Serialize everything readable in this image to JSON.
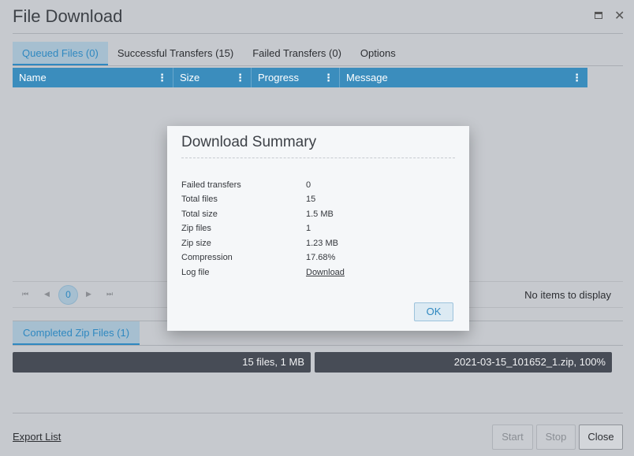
{
  "window": {
    "title": "File Download"
  },
  "tabs": [
    {
      "label": "Queued Files (0)",
      "active": true
    },
    {
      "label": "Successful Transfers (15)",
      "active": false
    },
    {
      "label": "Failed Transfers (0)",
      "active": false
    },
    {
      "label": "Options",
      "active": false
    }
  ],
  "grid": {
    "columns": [
      "Name",
      "Size",
      "Progress",
      "Message"
    ],
    "menu_glyph": "⋮"
  },
  "pager": {
    "first": "⏮",
    "prev": "◀",
    "page": "0",
    "next": "▶",
    "last": "⏭",
    "status": "No items to display"
  },
  "zip_tab": {
    "label": "Completed Zip Files (1)"
  },
  "zip_rows": [
    {
      "files": "15 files, 1 MB",
      "zip": "2021-03-15_101652_1.zip, 100%"
    }
  ],
  "footer": {
    "export": "Export List",
    "start": "Start",
    "stop": "Stop",
    "close": "Close"
  },
  "icons": {
    "maximize": "maximize-icon",
    "close": "close-icon"
  },
  "modal": {
    "title": "Download Summary",
    "rows": [
      {
        "label": "Failed transfers",
        "value": "0"
      },
      {
        "label": "Total files",
        "value": "15"
      },
      {
        "label": "Total size",
        "value": "1.5 MB"
      },
      {
        "label": "Zip files",
        "value": "1"
      },
      {
        "label": "Zip size",
        "value": "1.23 MB"
      },
      {
        "label": "Compression",
        "value": "17.68%"
      },
      {
        "label": "Log file",
        "value": "Download"
      }
    ],
    "ok": "OK"
  },
  "colors": {
    "accent": "#2f88c0",
    "grid_header": "#3b8dbd",
    "zip_bar": "#474c56"
  }
}
